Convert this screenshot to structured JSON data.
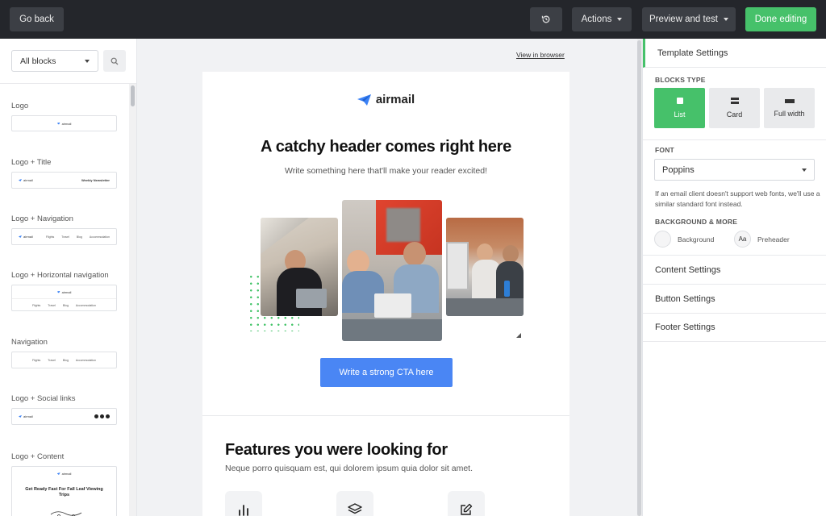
{
  "topbar": {
    "back_label": "Go back",
    "history_icon": "history-icon",
    "actions_label": "Actions",
    "preview_label": "Preview and test",
    "done_label": "Done editing"
  },
  "left_panel": {
    "filter_value": "All blocks",
    "search_icon": "search-icon",
    "blocks": [
      {
        "label": "Logo"
      },
      {
        "label": "Logo + Title",
        "title_text": "Weekly Newsletter"
      },
      {
        "label": "Logo + Navigation"
      },
      {
        "label": "Logo + Horizontal navigation"
      },
      {
        "label": "Navigation"
      },
      {
        "label": "Logo + Social links"
      },
      {
        "label": "Logo + Content",
        "content_text": "Get Ready Fast For Fall Leaf Viewing Trips"
      }
    ],
    "mini_logo": "airmail",
    "mini_nav": [
      "Flights",
      "Travel",
      "Blog",
      "Accommodation"
    ]
  },
  "canvas": {
    "view_in_browser": "View in browser",
    "logo_text": "airmail",
    "header": "A catchy header comes right here",
    "subheader": "Write something here that'll make your reader excited!",
    "cta_label": "Write a strong CTA here",
    "features_title": "Features you were looking for",
    "features_text": "Neque porro quisquam est, qui dolorem ipsum quia dolor sit amet.",
    "feature_icons": [
      "bar-chart-icon",
      "layers-icon",
      "edit-icon"
    ]
  },
  "right_panel": {
    "title": "Template Settings",
    "blocks_type_label": "BLOCKS TYPE",
    "block_types": [
      {
        "label": "List",
        "active": true
      },
      {
        "label": "Card",
        "active": false
      },
      {
        "label": "Full width",
        "active": false
      }
    ],
    "font_label": "FONT",
    "font_value": "Poppins",
    "font_note": "If an email client doesn't support web fonts, we'll use a similar standard font instead.",
    "background_label": "BACKGROUND & MORE",
    "background_option": "Background",
    "preheader_option": "Preheader",
    "preheader_glyph": "Aa",
    "sections": [
      "Content Settings",
      "Button Settings",
      "Footer Settings"
    ]
  },
  "colors": {
    "accent_green": "#46c16a",
    "cta_blue": "#4a86f4",
    "topbar": "#24262b"
  }
}
